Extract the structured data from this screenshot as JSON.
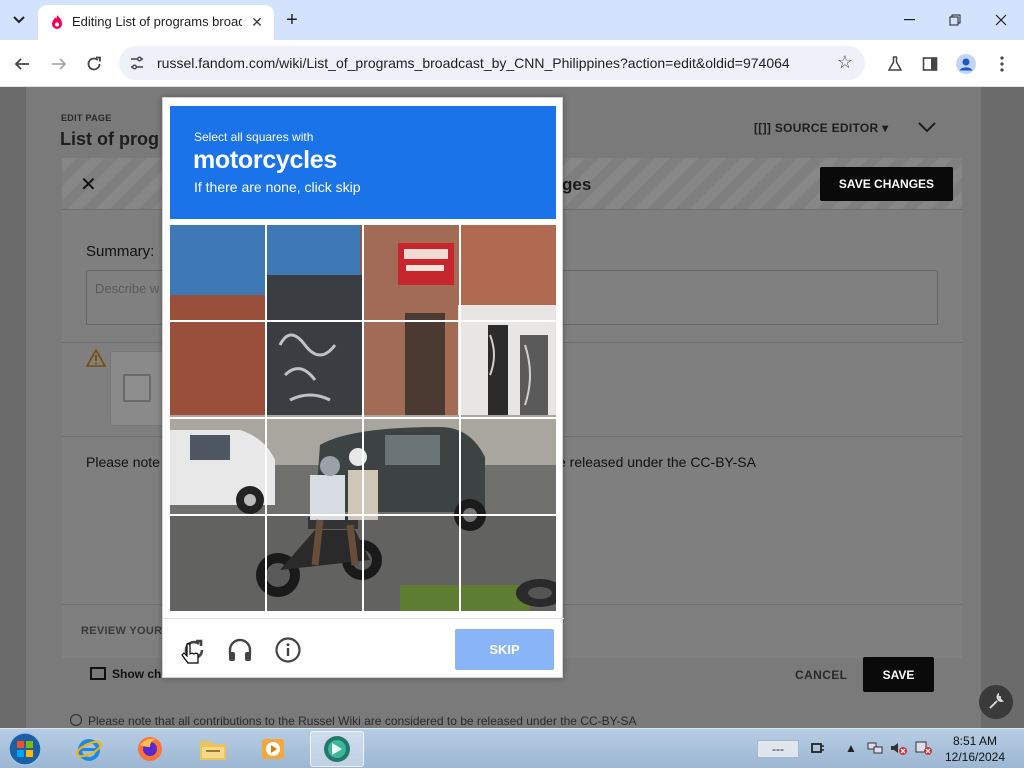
{
  "browser": {
    "tab_title": "Editing List of programs broadcast by CNN Philippines",
    "url": "russel.fandom.com/wiki/List_of_programs_broadcast_by_CNN_Philippines?action=edit&oldid=974064"
  },
  "page": {
    "edit_label": "EDIT PAGE",
    "title": "List of prog",
    "source_editor": "[[]] SOURCE EDITOR",
    "panel_title": "ges",
    "save_changes": "SAVE CHANGES",
    "summary_label": "Summary:",
    "summary_placeholder": "Describe w",
    "note_left": "Please note",
    "note_right": "e released under the CC-BY-SA",
    "review_label": "REVIEW YOUR",
    "show_changes": "Show ch",
    "cancel": "CANCEL",
    "save": "SAVE",
    "license_note": "Please note that all contributions to the Russel Wiki are considered to be released under the CC-BY-SA"
  },
  "captcha": {
    "instruction": "Select all squares with",
    "target": "motorcycles",
    "hint": "If there are none, click skip",
    "skip": "SKIP"
  },
  "taskbar": {
    "lang": "---",
    "time": "8:51 AM",
    "date": "12/16/2024"
  },
  "colors": {
    "captcha_blue": "#1a73e8",
    "skip_blue": "#8ab4f8",
    "tab_strip": "#d3e3fd"
  }
}
